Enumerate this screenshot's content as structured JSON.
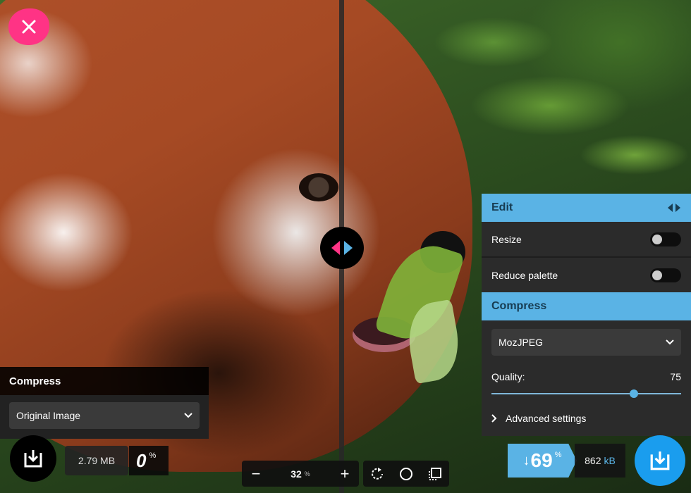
{
  "left_panel": {
    "header": "Compress",
    "method_select": "Original Image",
    "file_size": "2.79 MB",
    "reduction_value": "0",
    "reduction_symbol": "%"
  },
  "zoom": {
    "minus_label": "−",
    "value": "32",
    "unit": "%",
    "plus_label": "+"
  },
  "right_panel": {
    "edit_header": "Edit",
    "options": [
      {
        "label": "Resize",
        "enabled": false
      },
      {
        "label": "Reduce palette",
        "enabled": false
      }
    ],
    "compress_header": "Compress",
    "codec_select": "MozJPEG",
    "quality_label": "Quality:",
    "quality_value": "75",
    "quality_fraction": 0.75,
    "advanced_label": "Advanced settings"
  },
  "result": {
    "arrow": "↓",
    "reduction_value": "69",
    "reduction_symbol": "%",
    "size_value": "862",
    "size_unit": "kB"
  },
  "colors": {
    "accent_pink": "#ff3385",
    "accent_blue": "#5ab3e5",
    "download_blue": "#1a9dee"
  },
  "icons": [
    "close-icon",
    "compare-arrows-icon",
    "download-icon",
    "chevron-down-icon",
    "rotate-icon",
    "circle-background-icon",
    "crop-outline-icon",
    "chevron-right-icon",
    "swap-sides-icon"
  ]
}
